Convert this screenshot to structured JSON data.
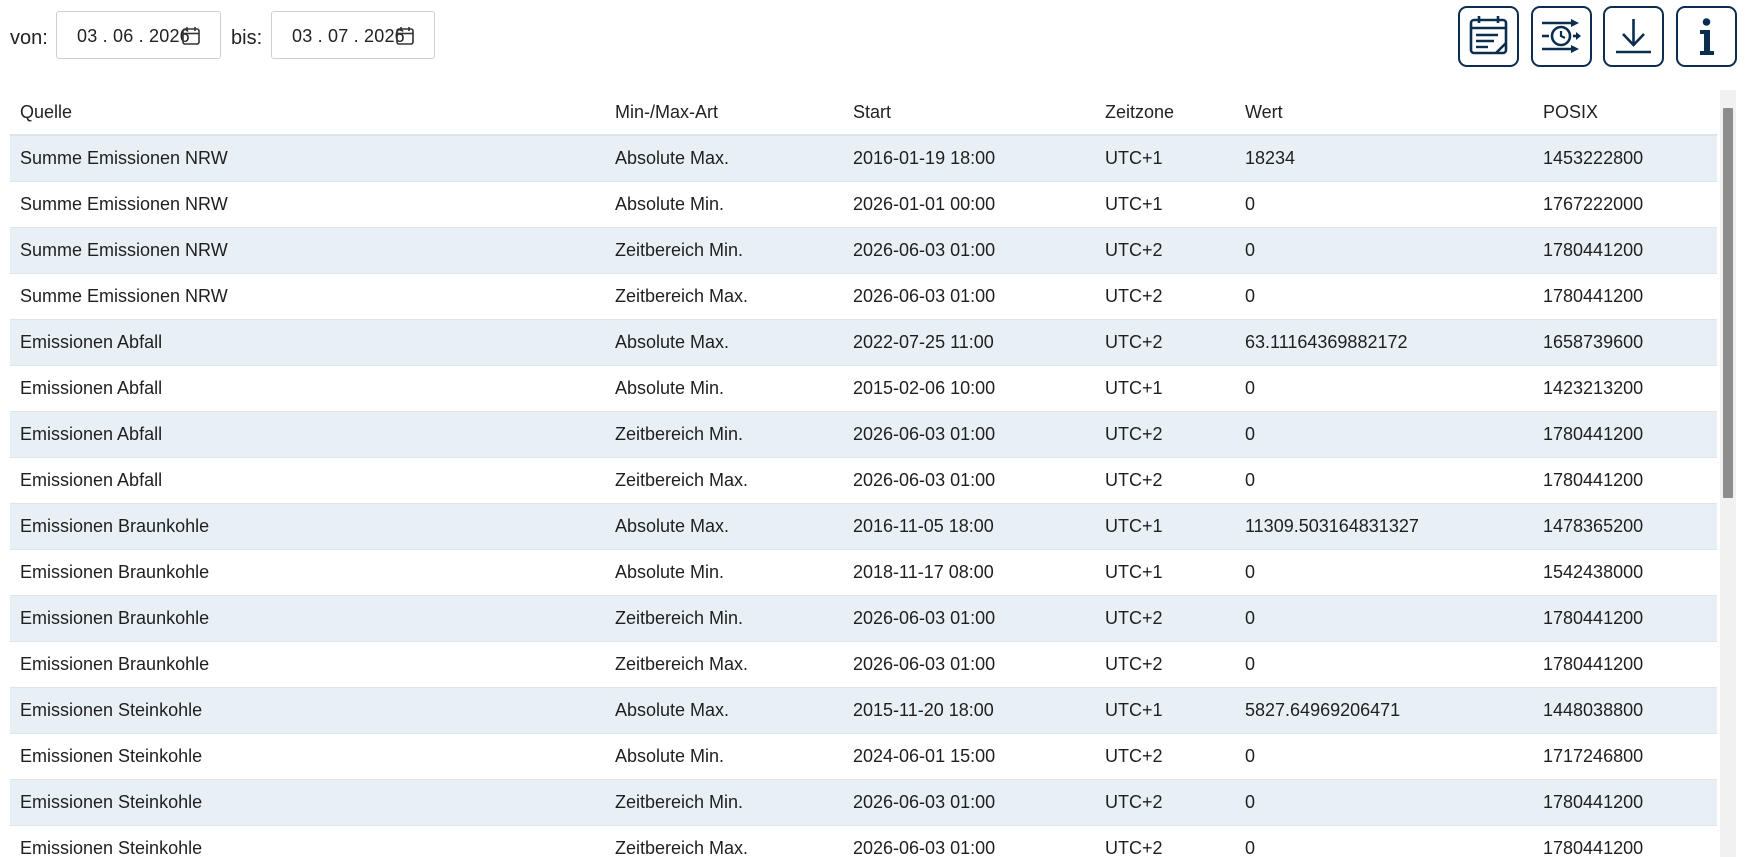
{
  "filters": {
    "from_label": "von:",
    "from_value": "03 . 06 . 2026",
    "to_label": "bis:",
    "to_value": "03 . 07 . 2026"
  },
  "toolbar": {
    "buttons": [
      {
        "icon": "calendar-notes-icon"
      },
      {
        "icon": "schedule-filter-icon"
      },
      {
        "icon": "download-icon"
      },
      {
        "icon": "info-icon"
      }
    ],
    "color": "#0b2d4f"
  },
  "table": {
    "columns": [
      "Quelle",
      "Min-/Max-Art",
      "Start",
      "Zeitzone",
      "Wert",
      "POSIX"
    ],
    "rows": [
      [
        "Summe Emissionen NRW",
        "Absolute Max.",
        "2016-01-19 18:00",
        "UTC+1",
        "18234",
        "1453222800"
      ],
      [
        "Summe Emissionen NRW",
        "Absolute Min.",
        "2026-01-01 00:00",
        "UTC+1",
        "0",
        "1767222000"
      ],
      [
        "Summe Emissionen NRW",
        "Zeitbereich Min.",
        "2026-06-03 01:00",
        "UTC+2",
        "0",
        "1780441200"
      ],
      [
        "Summe Emissionen NRW",
        "Zeitbereich Max.",
        "2026-06-03 01:00",
        "UTC+2",
        "0",
        "1780441200"
      ],
      [
        "Emissionen Abfall",
        "Absolute Max.",
        "2022-07-25 11:00",
        "UTC+2",
        "63.11164369882172",
        "1658739600"
      ],
      [
        "Emissionen Abfall",
        "Absolute Min.",
        "2015-02-06 10:00",
        "UTC+1",
        "0",
        "1423213200"
      ],
      [
        "Emissionen Abfall",
        "Zeitbereich Min.",
        "2026-06-03 01:00",
        "UTC+2",
        "0",
        "1780441200"
      ],
      [
        "Emissionen Abfall",
        "Zeitbereich Max.",
        "2026-06-03 01:00",
        "UTC+2",
        "0",
        "1780441200"
      ],
      [
        "Emissionen Braunkohle",
        "Absolute Max.",
        "2016-11-05 18:00",
        "UTC+1",
        "11309.503164831327",
        "1478365200"
      ],
      [
        "Emissionen Braunkohle",
        "Absolute Min.",
        "2018-11-17 08:00",
        "UTC+1",
        "0",
        "1542438000"
      ],
      [
        "Emissionen Braunkohle",
        "Zeitbereich Min.",
        "2026-06-03 01:00",
        "UTC+2",
        "0",
        "1780441200"
      ],
      [
        "Emissionen Braunkohle",
        "Zeitbereich Max.",
        "2026-06-03 01:00",
        "UTC+2",
        "0",
        "1780441200"
      ],
      [
        "Emissionen Steinkohle",
        "Absolute Max.",
        "2015-11-20 18:00",
        "UTC+1",
        "5827.64969206471",
        "1448038800"
      ],
      [
        "Emissionen Steinkohle",
        "Absolute Min.",
        "2024-06-01 15:00",
        "UTC+2",
        "0",
        "1717246800"
      ],
      [
        "Emissionen Steinkohle",
        "Zeitbereich Min.",
        "2026-06-03 01:00",
        "UTC+2",
        "0",
        "1780441200"
      ],
      [
        "Emissionen Steinkohle",
        "Zeitbereich Max.",
        "2026-06-03 01:00",
        "UTC+2",
        "0",
        "1780441200"
      ]
    ]
  }
}
